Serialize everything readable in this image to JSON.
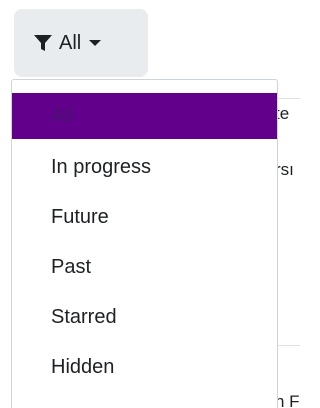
{
  "filter": {
    "icon": "filter-icon",
    "label": "All",
    "caret": "caret-down-icon"
  },
  "menu": {
    "items": [
      {
        "label": "All",
        "active": true
      },
      {
        "label": "In progress",
        "active": false
      },
      {
        "label": "Future",
        "active": false
      },
      {
        "label": "Past",
        "active": false
      },
      {
        "label": "Starred",
        "active": false
      },
      {
        "label": "Hidden",
        "active": false
      }
    ]
  },
  "background": {
    "fragments": [
      "te",
      "rsı",
      "h F"
    ]
  },
  "colors": {
    "active_bg": "#62008c",
    "button_bg": "#e9ecef",
    "text": "#1d2125",
    "border": "#cfd4da"
  }
}
